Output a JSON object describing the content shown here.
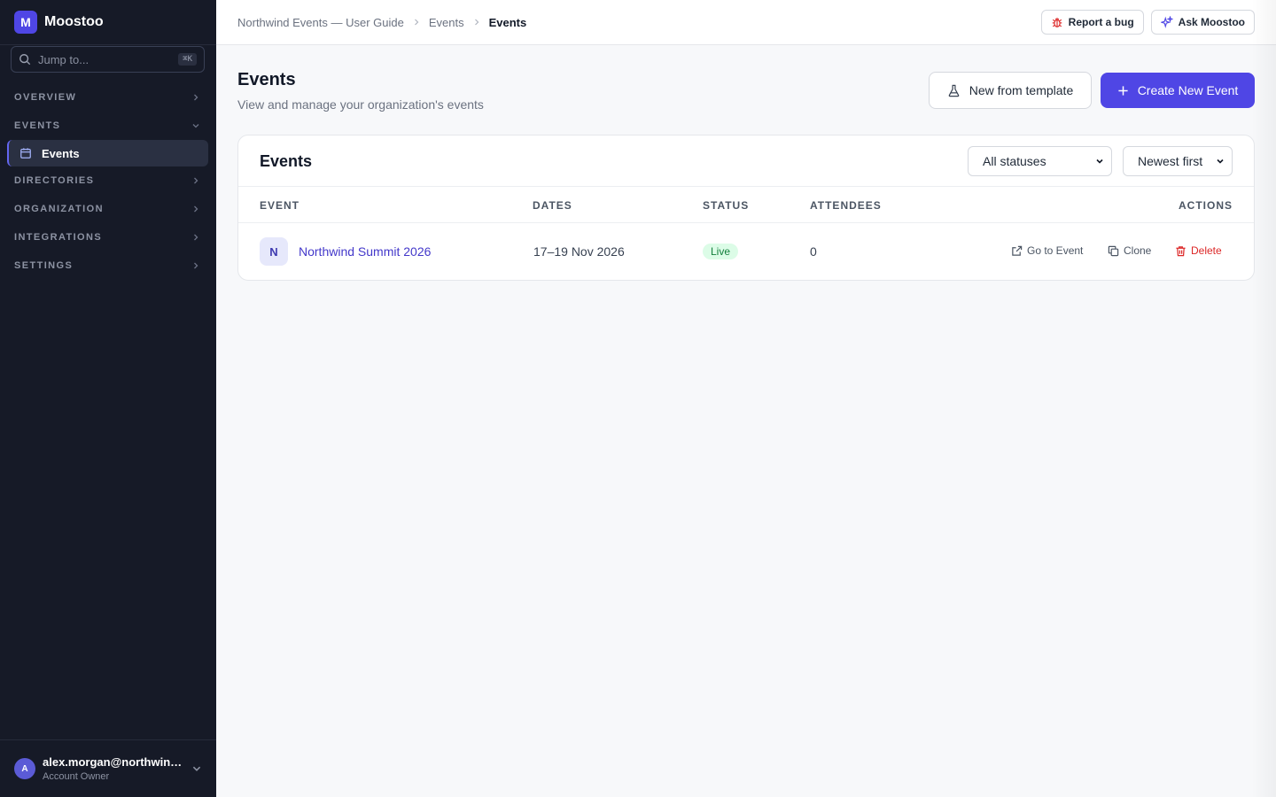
{
  "app": {
    "badge": "M",
    "name": "Moostoo"
  },
  "search": {
    "placeholder": "Jump to...",
    "shortcut": "⌘K"
  },
  "nav": {
    "sections": [
      "OVERVIEW",
      "EVENTS",
      "DIRECTORIES",
      "ORGANIZATION",
      "INTEGRATIONS",
      "SETTINGS"
    ],
    "active_item": "Events"
  },
  "user": {
    "initial": "A",
    "email": "alex.morgan@northwind...",
    "role": "Account Owner"
  },
  "breadcrumb": [
    "Northwind Events — User Guide",
    "Events",
    "Events"
  ],
  "topbar": {
    "report_bug": "Report a bug",
    "ask": "Ask Moostoo"
  },
  "page": {
    "title": "Events",
    "subtitle": "View and manage your organization's events",
    "new_from_template": "New from template",
    "create_new": "Create New Event"
  },
  "card": {
    "title": "Events",
    "status_filter": "All statuses",
    "sort": "Newest first"
  },
  "table": {
    "columns": [
      "EVENT",
      "DATES",
      "STATUS",
      "ATTENDEES",
      "ACTIONS"
    ],
    "rows": [
      {
        "initial": "N",
        "name": "Northwind Summit 2026",
        "dates": "17–19 Nov 2026",
        "status": "Live",
        "attendees": "0"
      }
    ],
    "actions": {
      "go": "Go to Event",
      "clone": "Clone",
      "delete": "Delete"
    }
  },
  "colors": {
    "accent": "#4f46e5",
    "sidebar_bg": "#161a27",
    "live": "#15803d",
    "danger": "#dc2626"
  }
}
